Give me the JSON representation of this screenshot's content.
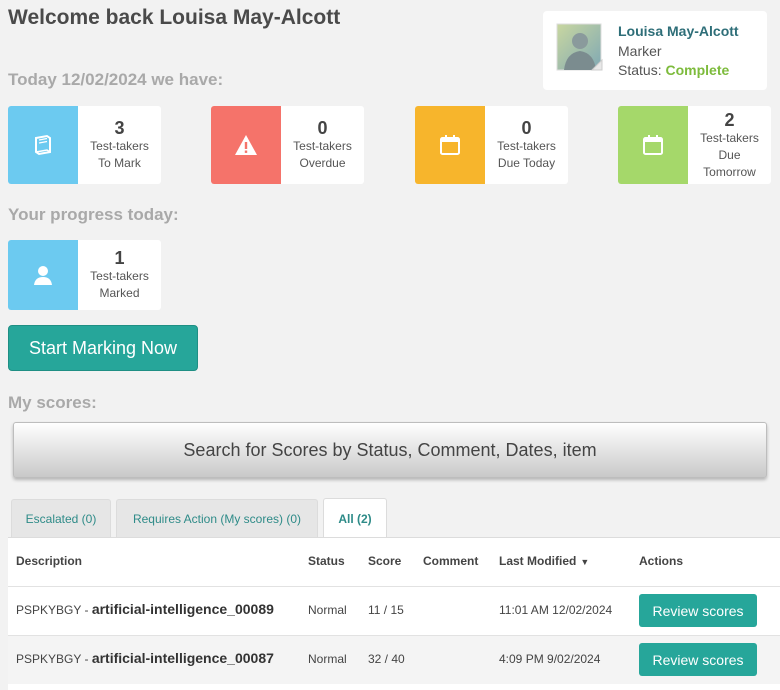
{
  "welcome": "Welcome back Louisa May-Alcott",
  "profile": {
    "name": "Louisa May-Alcott",
    "role": "Marker",
    "status_label": "Status:",
    "status_value": "Complete",
    "status_color": "#7dbb3c"
  },
  "today_heading": "Today 12/02/2024 we have:",
  "today_stats": [
    {
      "count": "3",
      "label1": "Test-takers",
      "label2": "To Mark",
      "label3": "",
      "icon": "book-icon",
      "color": "#6ccaf0"
    },
    {
      "count": "0",
      "label1": "Test-takers",
      "label2": "Overdue",
      "label3": "",
      "icon": "warning-icon",
      "color": "#f5736a"
    },
    {
      "count": "0",
      "label1": "Test-takers",
      "label2": "Due Today",
      "label3": "",
      "icon": "calendar-icon",
      "color": "#f7b52c"
    },
    {
      "count": "2",
      "label1": "Test-takers",
      "label2": "Due",
      "label3": "Tomorrow",
      "icon": "calendar-icon",
      "color": "#a5d86a"
    }
  ],
  "progress_heading": "Your progress today:",
  "progress_stat": {
    "count": "1",
    "label1": "Test-takers",
    "label2": "Marked",
    "icon": "user-icon",
    "color": "#6ccaf0"
  },
  "start_button": "Start Marking Now",
  "scores_heading": "My scores:",
  "search_bar": "Search for Scores by Status, Comment, Dates, item",
  "tabs": [
    {
      "label": "Escalated (0)"
    },
    {
      "label": "Requires Action (My scores) (0)"
    },
    {
      "label": "All (2)"
    }
  ],
  "table": {
    "headers": [
      "Description",
      "Status",
      "Score",
      "Comment",
      "Last Modified",
      "Actions"
    ],
    "rows": [
      {
        "code": "PSPKYBGY - ",
        "name": "artificial-intelligence_00089",
        "status": "Normal",
        "score": "11 / 15",
        "comment": "",
        "modified": "11:01 AM 12/02/2024",
        "action": "Review scores"
      },
      {
        "code": "PSPKYBGY - ",
        "name": "artificial-intelligence_00087",
        "status": "Normal",
        "score": "32 / 40",
        "comment": "",
        "modified": "4:09 PM 9/02/2024",
        "action": "Review scores"
      }
    ]
  },
  "accent_color": "#26a69a"
}
